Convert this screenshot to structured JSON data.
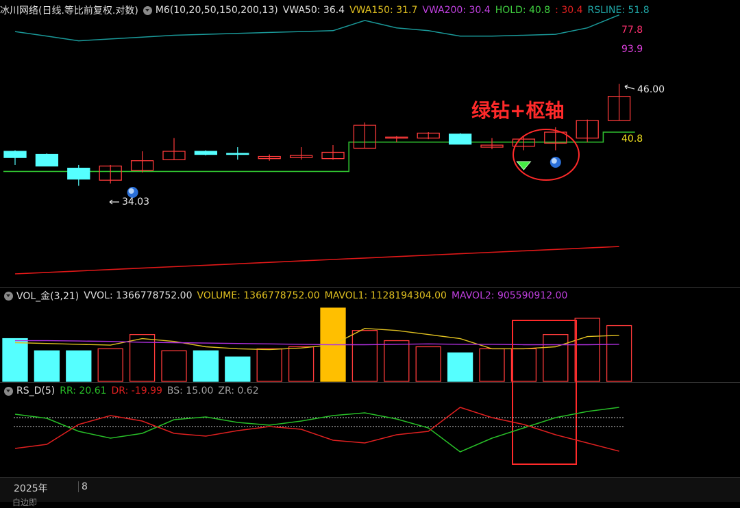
{
  "price_header": {
    "title": "冰川网络(日线.等比前复权.对数)",
    "ma": "M6(10,20,50,150,200,13)",
    "vwa50": "VWA50: 36.4",
    "vwa150": "VWA150: 31.7",
    "vwa200": "VWA200: 30.4",
    "hold": "HOLD: 40.8",
    "hold_extra": ": 30.4",
    "rsline": "RSLINE: 51.8"
  },
  "vol_header": {
    "title": "VOL_金(3,21)",
    "vvol": "VVOL: 1366778752.00",
    "volume": "VOLUME: 1366778752.00",
    "mavol1": "MAVOL1: 1128194304.00",
    "mavol2": "MAVOL2: 905590912.00"
  },
  "rs_header": {
    "title": "RS_D(5)",
    "rr": "RR: 20.61",
    "dr": "DR: -19.99",
    "bs": "BS: 15.00",
    "zr": "ZR: 0.62"
  },
  "labels": {
    "rs_top": "77.8",
    "rs_value": "93.9",
    "high": "46.00",
    "hold_value": "40.8",
    "low": "34.03",
    "annotation": "绿钻+枢轴"
  },
  "footer": {
    "year": "2025年",
    "month": "8",
    "cut_label": "白边即"
  },
  "colors": {
    "up": "#ff3b3b",
    "down": "#55ffff",
    "hold_line": "#2fbf2f",
    "rs_line": "#1a9a9a",
    "ma_red": "#e01818",
    "vol_ma1": "#e0c020",
    "vol_ma2": "#b030e0",
    "big_vol": "#ffbf00",
    "rr": "#28c028",
    "dr": "#e02020",
    "annotation": "#ff2a2a"
  },
  "chart_data": {
    "type": "candlestick",
    "candles": [
      {
        "o": 38.9,
        "h": 39.0,
        "l": 37.6,
        "c": 38.3
      },
      {
        "o": 38.6,
        "h": 38.7,
        "l": 37.5,
        "c": 37.5
      },
      {
        "o": 37.3,
        "h": 37.6,
        "l": 35.7,
        "c": 36.3
      },
      {
        "o": 36.2,
        "h": 37.6,
        "l": 35.9,
        "c": 37.5
      },
      {
        "o": 37.1,
        "h": 38.9,
        "l": 36.9,
        "c": 38.0
      },
      {
        "o": 38.1,
        "h": 40.2,
        "l": 38.1,
        "c": 38.9
      },
      {
        "o": 38.9,
        "h": 39.0,
        "l": 38.5,
        "c": 38.6
      },
      {
        "o": 38.7,
        "h": 39.3,
        "l": 38.1,
        "c": 38.6
      },
      {
        "o": 38.2,
        "h": 38.6,
        "l": 38.0,
        "c": 38.4
      },
      {
        "o": 38.3,
        "h": 39.3,
        "l": 38.1,
        "c": 38.5
      },
      {
        "o": 38.2,
        "h": 39.5,
        "l": 38.1,
        "c": 38.8
      },
      {
        "o": 39.2,
        "h": 41.8,
        "l": 39.2,
        "c": 41.5
      },
      {
        "o": 40.2,
        "h": 40.4,
        "l": 39.8,
        "c": 40.3
      },
      {
        "o": 40.2,
        "h": 40.8,
        "l": 40.1,
        "c": 40.7
      },
      {
        "o": 40.6,
        "h": 40.7,
        "l": 39.6,
        "c": 39.6
      },
      {
        "o": 39.3,
        "h": 40.2,
        "l": 39.1,
        "c": 39.5
      },
      {
        "o": 39.4,
        "h": 40.3,
        "l": 39.0,
        "c": 40.1
      },
      {
        "o": 39.7,
        "h": 41.3,
        "l": 39.0,
        "c": 40.8
      },
      {
        "o": 40.2,
        "h": 42.1,
        "l": 39.8,
        "c": 42.0
      },
      {
        "o": 42.0,
        "h": 46.0,
        "l": 42.0,
        "c": 44.6
      }
    ],
    "hold": [
      37.0,
      37.0,
      37.0,
      37.0,
      37.0,
      37.0,
      37.0,
      37.0,
      37.0,
      37.0,
      37.0,
      39.8,
      39.8,
      39.8,
      39.8,
      39.8,
      39.8,
      39.8,
      39.8,
      40.8
    ],
    "rsline": [
      57.0,
      54.5,
      52.0,
      53.0,
      54.0,
      55.0,
      55.5,
      56.0,
      56.5,
      57.0,
      57.5,
      63.0,
      59.0,
      57.5,
      54.5,
      54.5,
      55.0,
      55.5,
      59.0,
      66.0
    ],
    "ma_red": [
      30.0,
      30.1,
      30.2,
      30.3,
      30.4,
      30.5,
      30.6,
      30.7,
      30.8,
      30.9,
      31.0,
      31.1,
      31.2,
      31.3,
      31.4,
      31.5,
      31.6,
      31.7,
      31.8,
      31.9
    ],
    "volume": [
      1.05,
      0.75,
      0.75,
      0.8,
      1.15,
      0.75,
      0.75,
      0.6,
      0.8,
      0.85,
      1.8,
      1.25,
      1.0,
      0.85,
      0.7,
      0.8,
      0.8,
      1.15,
      1.55,
      1.37
    ],
    "vol_ma1": [
      0.95,
      0.93,
      0.91,
      0.89,
      1.05,
      0.98,
      0.85,
      0.8,
      0.78,
      0.82,
      0.9,
      1.3,
      1.25,
      1.15,
      1.05,
      0.8,
      0.8,
      0.85,
      1.1,
      1.13
    ],
    "vol_ma2": [
      1.0,
      1.0,
      0.99,
      0.98,
      0.96,
      0.95,
      0.94,
      0.93,
      0.92,
      0.91,
      0.9,
      0.9,
      0.91,
      0.92,
      0.91,
      0.91,
      0.9,
      0.9,
      0.9,
      0.91
    ],
    "rr": [
      90,
      84,
      65,
      55,
      62,
      82,
      86,
      78,
      74,
      80,
      88,
      92,
      83,
      70,
      35,
      55,
      70,
      85,
      94,
      100
    ],
    "dr": [
      40,
      46,
      75,
      88,
      80,
      62,
      58,
      66,
      72,
      68,
      52,
      48,
      60,
      65,
      100,
      85,
      75,
      60,
      48,
      36
    ],
    "rs_upper": 85,
    "rs_lower": 72
  }
}
